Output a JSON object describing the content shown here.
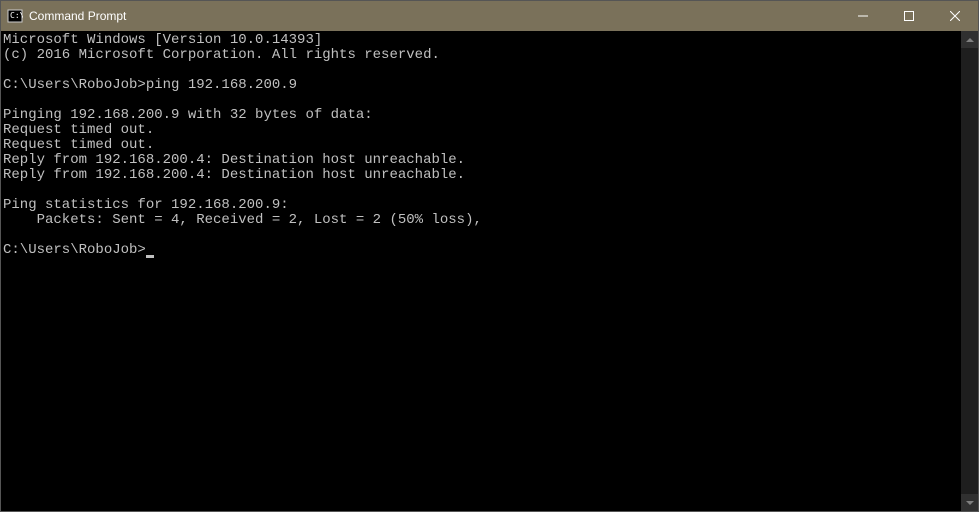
{
  "window": {
    "title": "Command Prompt"
  },
  "terminal": {
    "lines": [
      "Microsoft Windows [Version 10.0.14393]",
      "(c) 2016 Microsoft Corporation. All rights reserved.",
      "",
      "C:\\Users\\RoboJob>ping 192.168.200.9",
      "",
      "Pinging 192.168.200.9 with 32 bytes of data:",
      "Request timed out.",
      "Request timed out.",
      "Reply from 192.168.200.4: Destination host unreachable.",
      "Reply from 192.168.200.4: Destination host unreachable.",
      "",
      "Ping statistics for 192.168.200.9:",
      "    Packets: Sent = 4, Received = 2, Lost = 2 (50% loss),",
      ""
    ],
    "prompt": "C:\\Users\\RoboJob>"
  }
}
